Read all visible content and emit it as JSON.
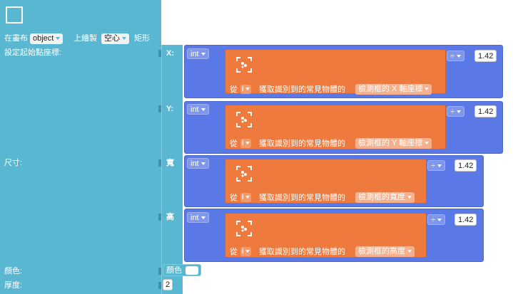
{
  "top_block": {
    "canvas_prefix": "在畫布",
    "canvas_value": "object",
    "mid_text": "上繪製",
    "fill_value": "空心",
    "shape_text": "矩形",
    "start_label": "設定起始點座標:",
    "size_label": "尺寸:",
    "color_label": "顏色:",
    "thickness_label": "厚度:"
  },
  "rows": [
    {
      "axis_label": "X:",
      "cast": "int",
      "prefix": "從",
      "var": "i",
      "middle": "獲取識別到的常見物體的",
      "property": "檢測框的 X 軸座標",
      "op": "÷",
      "value": "1.42"
    },
    {
      "axis_label": "Y:",
      "cast": "int",
      "prefix": "從",
      "var": "i",
      "middle": "獲取識別到的常見物體的",
      "property": "檢測框的 Y 軸座標",
      "op": "÷",
      "value": "1.42"
    },
    {
      "axis_label": "寬",
      "cast": "int",
      "prefix": "從",
      "var": "i",
      "middle": "獲取識別到的常見物體的",
      "property": "檢測框的寬度",
      "op": "÷",
      "value": "1.42"
    },
    {
      "axis_label": "高",
      "cast": "int",
      "prefix": "從",
      "var": "i",
      "middle": "獲取識別到的常見物體的",
      "property": "檢測框的高度",
      "op": "÷",
      "value": "1.42"
    }
  ],
  "color_input": {
    "label": "顏色",
    "value_color": "#ffffff"
  },
  "thickness_input": {
    "value": "2"
  },
  "colors": {
    "teal": "#5ab7d2",
    "blue": "#5a79e6",
    "orange": "#ef7a3e"
  },
  "icons": {
    "checkbox": "checkbox-outline-icon",
    "detect": "object-detect-icon"
  }
}
